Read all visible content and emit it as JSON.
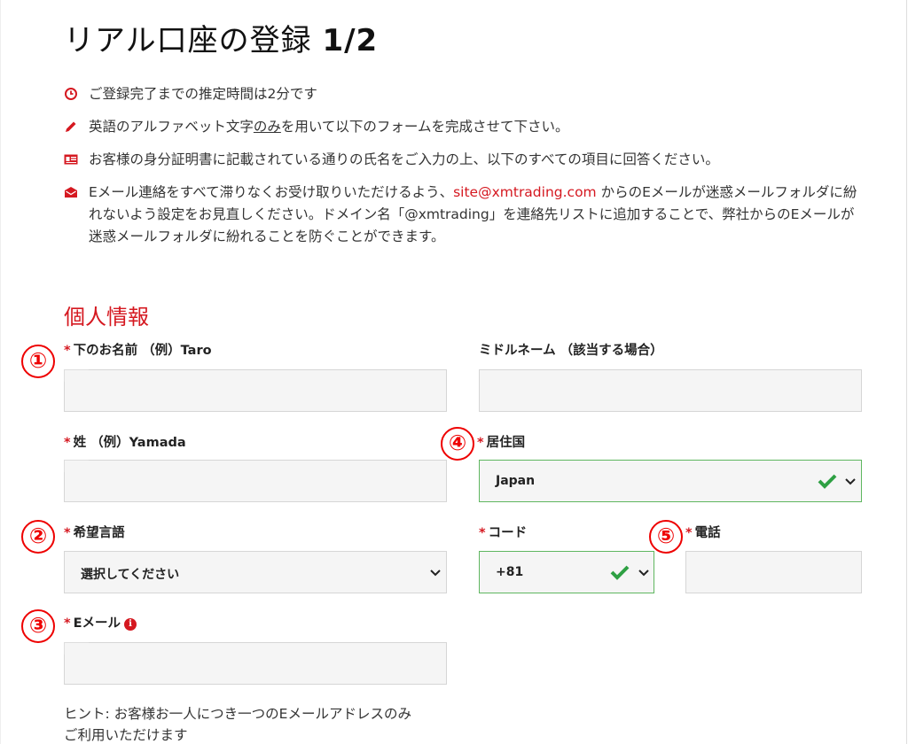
{
  "page": {
    "title_main": "リアル口座の登録 ",
    "title_step": "1/2"
  },
  "notes": {
    "time": "ご登録完了までの推定時間は2分です",
    "alphabet_pre": "英語のアルファベット文字",
    "alphabet_under": "のみ",
    "alphabet_post": "を用いて以下のフォームを完成させて下さい。",
    "id": "お客様の身分証明書に記載されている通りの氏名をご入力の上、以下のすべての項目に回答ください。",
    "email_pre": "Eメール連絡をすべて滞りなくお受け取りいただけるよう、",
    "email_link": "site@xmtrading.com",
    "email_post": " からのEメールが迷惑メールフォルダに紛れないよう設定をお見直しください。ドメイン名「@xmtrading」を連絡先リストに追加することで、弊社からのEメールが迷惑メールフォルダに紛れることを防ぐことができます。"
  },
  "section": {
    "personal_info": "個人情報"
  },
  "form": {
    "required_mark": "*",
    "first_name_label": "下のお名前 （例）Taro",
    "first_name_value": "",
    "middle_name_label": "ミドルネーム （該当する場合）",
    "middle_name_value": "",
    "last_name_label": "姓 （例）Yamada",
    "last_name_value": "",
    "country_label": "居住国",
    "country_value": "Japan",
    "language_label": "希望言語",
    "language_value": "選択してください",
    "code_label": "コード",
    "code_value": "+81",
    "phone_label": "電話",
    "phone_value": "",
    "email_label": "Eメール",
    "email_value": "",
    "email_info_glyph": "i",
    "hint_line1": "ヒント: お客様お一人につき一つのEメールアドレスのみ",
    "hint_line2": "ご利用いただけます"
  },
  "markers": [
    "①",
    "②",
    "③",
    "④",
    "⑤"
  ],
  "colors": {
    "accent": "#d51820",
    "valid": "#2ea043",
    "marker": "#ee0000"
  },
  "icons": [
    "clock-icon",
    "pencil-icon",
    "id-card-icon",
    "envelope-icon",
    "check-icon",
    "chevron-down-icon",
    "info-icon"
  ]
}
